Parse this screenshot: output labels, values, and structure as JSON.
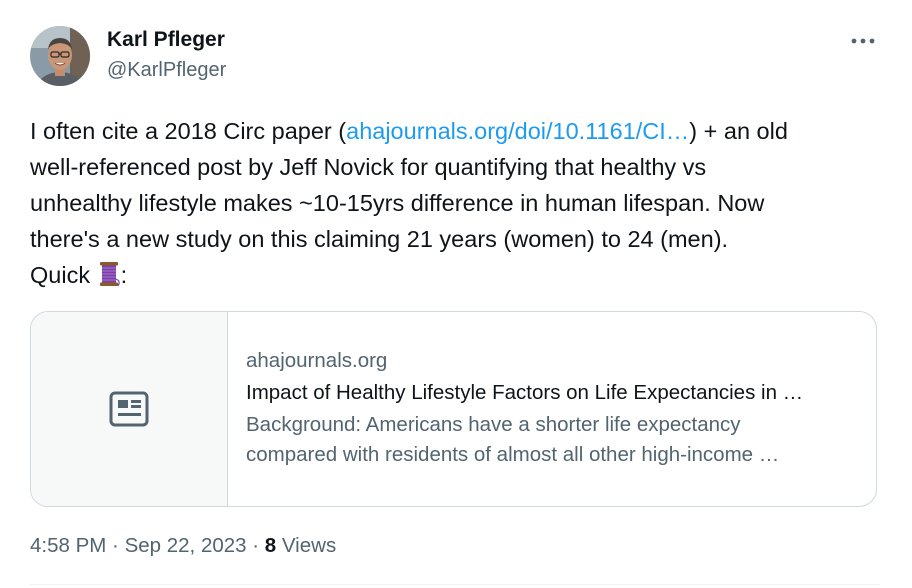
{
  "author": {
    "name": "Karl Pfleger",
    "handle": "@KarlPfleger",
    "avatar_icon": "person-avatar"
  },
  "menu": {
    "icon": "more-horizontal-icon"
  },
  "tweet": {
    "line1_before": "I often cite a 2018 Circ paper (",
    "link_text": "ahajournals.org/doi/10.1161/CI…",
    "line1_after": ") + an old",
    "line2": "well-referenced post by Jeff Novick for quantifying that healthy vs",
    "line3": "unhealthy lifestyle makes ~10-15yrs difference in human lifespan. Now",
    "line4": "there's a new study on this claiming 21 years (women) to 24 (men).",
    "line5_before": "Quick ",
    "thread_emoji": "🧵",
    "line5_after": ":"
  },
  "card": {
    "icon": "article-icon",
    "domain": "ahajournals.org",
    "title": "Impact of Healthy Lifestyle Factors on Life Expectancies in …",
    "desc_line1": "Background: Americans have a shorter life expectancy",
    "desc_line2": "compared with residents of almost all other high-income …"
  },
  "meta": {
    "time": "4:58 PM",
    "separator": " · ",
    "date": "Sep 22, 2023",
    "separator2": " · ",
    "views_count": "8",
    "views_label": " Views"
  },
  "colors": {
    "link": "#1d9bf0",
    "secondary": "#536471",
    "primary": "#0f1419",
    "border": "#cfd9de"
  }
}
